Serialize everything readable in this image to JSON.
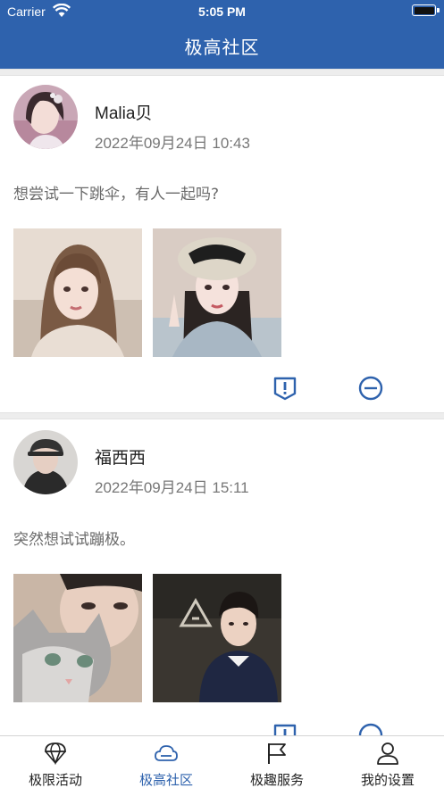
{
  "status_bar": {
    "carrier": "Carrier",
    "time": "5:05 PM"
  },
  "header": {
    "title": "极高社区"
  },
  "posts": [
    {
      "user": "Malia贝",
      "time": "2022年09月24日  10:43",
      "text": "想尝试一下跳伞，有人一起吗?",
      "actions": [
        "report-icon",
        "block-icon"
      ]
    },
    {
      "user": "福西西",
      "time": "2022年09月24日  15:11",
      "text": "突然想试试蹦极。",
      "actions": [
        "report-icon",
        "block-icon"
      ]
    }
  ],
  "tabs": [
    {
      "label": "极限活动",
      "icon": "parachute-icon",
      "active": false
    },
    {
      "label": "极高社区",
      "icon": "cloud-icon",
      "active": true
    },
    {
      "label": "极趣服务",
      "icon": "flag-icon",
      "active": false
    },
    {
      "label": "我的设置",
      "icon": "person-icon",
      "active": false
    }
  ],
  "colors": {
    "primary": "#2e62ad",
    "text": "#222222",
    "muted": "#777777"
  }
}
